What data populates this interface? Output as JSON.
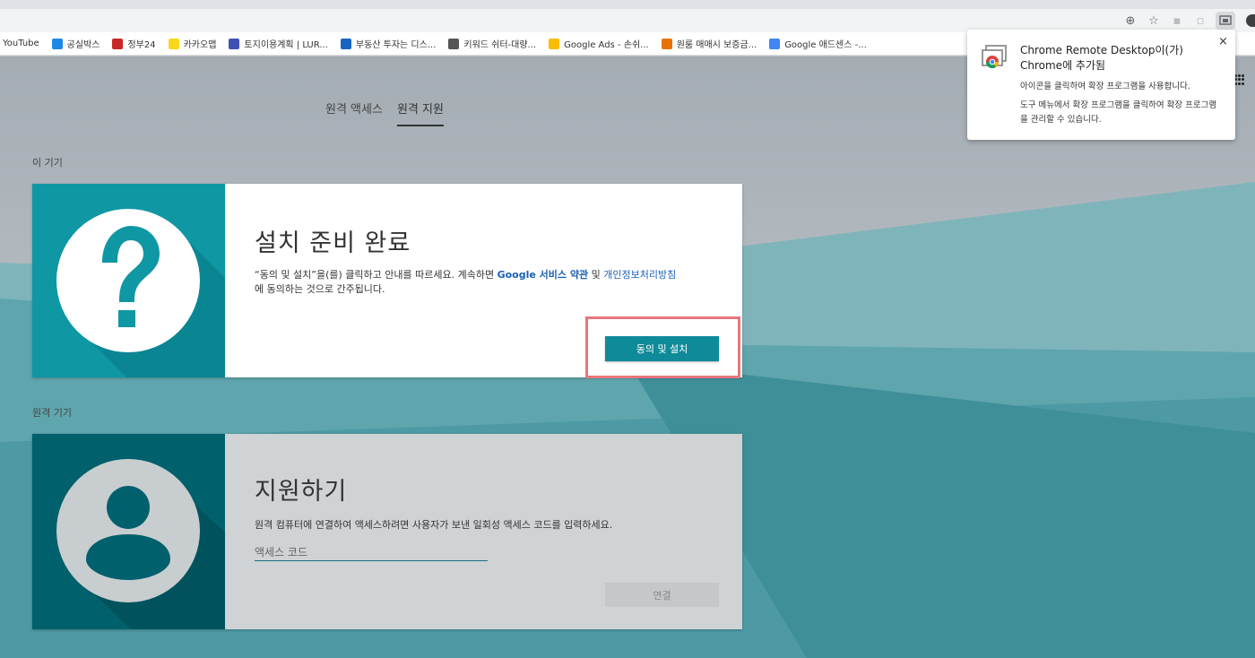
{
  "browser": {
    "bookmarks": [
      {
        "label": "YouTube",
        "icon": "youtube-icon",
        "color": "#ff0000"
      },
      {
        "label": "공실박스",
        "icon": "gongsil-icon",
        "color": "#1e88e5"
      },
      {
        "label": "정부24",
        "icon": "korea-gov-icon",
        "color": "#c62828"
      },
      {
        "label": "카카오맵",
        "icon": "kakaomap-icon",
        "color": "#f9d71c"
      },
      {
        "label": "토지이용계획 | LUR...",
        "icon": "luris-icon",
        "color": "#3f51b5"
      },
      {
        "label": "부동산 투자는 디스...",
        "icon": "chart-icon",
        "color": "#1565c0"
      },
      {
        "label": "키워드 쉬터-대량...",
        "icon": "globe-icon",
        "color": "#555555"
      },
      {
        "label": "Google Ads - 손쉬...",
        "icon": "google-ads-icon",
        "color": "#fbbc04"
      },
      {
        "label": "원룸 매매시 보증금...",
        "icon": "d-icon",
        "color": "#e8710a"
      },
      {
        "label": "Google 애드센스 -...",
        "icon": "google-icon",
        "color": "#4285f4"
      }
    ]
  },
  "tabs": [
    {
      "label": "원격 액세스"
    },
    {
      "label": "원격 지원"
    }
  ],
  "this_device": {
    "section_label": "이 기기",
    "title": "설치 준비 완료",
    "desc_part1": "“동의 및 설치”을(를) 클릭하고 안내를 따르세요. 계속하면 ",
    "desc_link1": "Google 서비스 약관",
    "desc_part2": " 및 ",
    "desc_link2": "개인정보처리방침",
    "desc_part3": "에 동의하는 것으로 간주됩니다.",
    "button_label": "동의 및 설치"
  },
  "remote_device": {
    "section_label": "원격 기기",
    "title": "지원하기",
    "desc": "원격 컴퓨터에 연결하여 액세스하려면 사용자가 보낸 일회성 액세스 코드를 입력하세요.",
    "input_placeholder": "액세스 코드",
    "button_label": "연결"
  },
  "popup": {
    "title": "Chrome Remote Desktop이(가) Chrome에 추가됨",
    "line1": "아이콘을 클릭하여 확장 프로그램을 사용합니다.",
    "line2": "도구 메뉴에서 확장 프로그램을 클릭하여 확장 프로그램을 관리할 수 있습니다.",
    "close": "×"
  },
  "colors": {
    "accent": "#0f8a98",
    "dark_teal": "#00606b",
    "highlight": "#e8767a"
  }
}
